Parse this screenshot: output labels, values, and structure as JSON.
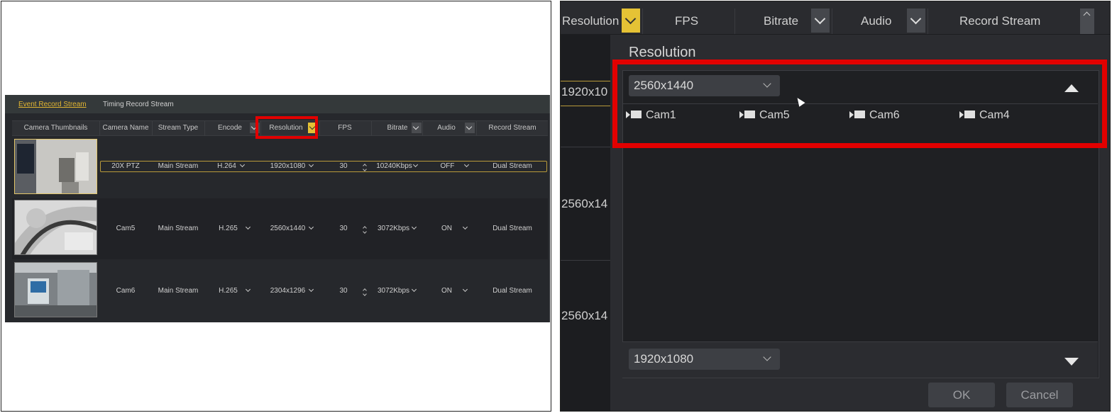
{
  "left": {
    "tabs": [
      "Event Record Stream",
      "Timing Record Stream"
    ],
    "columns": [
      "Camera Thumbnails",
      "Camera Name",
      "Stream Type",
      "Encode",
      "Resolution",
      "FPS",
      "Bitrate",
      "Audio",
      "Record Stream"
    ],
    "rows": [
      {
        "name": "20X PTZ",
        "stream_type": "Main Stream",
        "encode": "H.264",
        "resolution": "1920x1080",
        "fps": "30",
        "bitrate": "10240Kbps",
        "audio": "OFF",
        "record_stream": "Dual Stream"
      },
      {
        "name": "Cam5",
        "stream_type": "Main Stream",
        "encode": "H.265",
        "resolution": "2560x1440",
        "fps": "30",
        "bitrate": "3072Kbps",
        "audio": "ON",
        "record_stream": "Dual Stream"
      },
      {
        "name": "Cam6",
        "stream_type": "Main Stream",
        "encode": "H.265",
        "resolution": "2304x1296",
        "fps": "30",
        "bitrate": "3072Kbps",
        "audio": "ON",
        "record_stream": "Dual Stream"
      }
    ]
  },
  "right": {
    "columns": [
      "Resolution",
      "FPS",
      "Bitrate",
      "Audio",
      "Record Stream"
    ],
    "bg_values": [
      "1920x10",
      "2560x14",
      "2560x14"
    ],
    "dialog": {
      "title": "Resolution",
      "top_select": "2560x1440",
      "cameras": [
        "Cam1",
        "Cam5",
        "Cam6",
        "Cam4"
      ],
      "bottom_select": "1920x1080",
      "ok_label": "OK",
      "cancel_label": "Cancel"
    }
  },
  "colors": {
    "accent": "#e5c235",
    "highlight": "#e20000",
    "background": "#1c1d20"
  }
}
